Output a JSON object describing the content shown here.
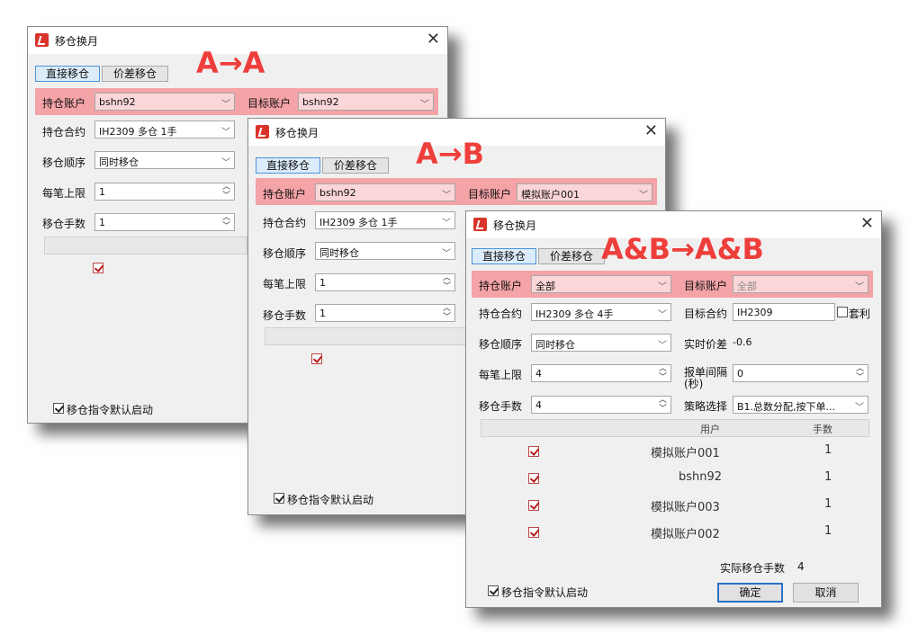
{
  "annotations": {
    "w1": "A→A",
    "w2": "A→B",
    "w3": "A&B→A&B"
  },
  "colors": {
    "highlight": "#f4a3a7",
    "annotation": "#ee3e3b",
    "accent": "#2a72c7"
  },
  "window1": {
    "title": "移仓换月",
    "tabs": [
      "直接移仓",
      "价差移仓"
    ],
    "hold_account_label": "持仓账户",
    "hold_account": "bshn92",
    "target_account_label": "目标账户",
    "target_account": "bshn92",
    "contract_label": "持仓合约",
    "contract": "IH2309 多仓 1手",
    "order_label": "移仓顺序",
    "order": "同时移仓",
    "max_label": "每笔上限",
    "max": "1",
    "qty_label": "移仓手数",
    "qty": "1",
    "default_start": "移仓指令默认启动"
  },
  "window2": {
    "title": "移仓换月",
    "tabs": [
      "直接移仓",
      "价差移仓"
    ],
    "hold_account_label": "持仓账户",
    "hold_account": "bshn92",
    "target_account_label": "目标账户",
    "target_account": "模拟账户001",
    "contract_label": "持仓合约",
    "contract": "IH2309 多仓 1手",
    "order_label": "移仓顺序",
    "order": "同时移仓",
    "max_label": "每笔上限",
    "max": "1",
    "qty_label": "移仓手数",
    "qty": "1",
    "default_start": "移仓指令默认启动"
  },
  "window3": {
    "title": "移仓换月",
    "tabs": [
      "直接移仓",
      "价差移仓"
    ],
    "hold_account_label": "持仓账户",
    "hold_account": "全部",
    "target_account_label": "目标账户",
    "target_account": "全部",
    "contract_label": "持仓合约",
    "contract": "IH2309 多仓 4手",
    "target_contract_label": "目标合约",
    "target_contract": "IH2309",
    "arb_label": "套利",
    "order_label": "移仓顺序",
    "order": "同时移仓",
    "spread_label": "实时价差",
    "spread": "-0.6",
    "max_label": "每笔上限",
    "max": "4",
    "interval_label": "报单间隔\n(秒)",
    "interval": "0",
    "qty_label": "移仓手数",
    "qty": "4",
    "strategy_label": "策略选择",
    "strategy": "B1.总数分配,按下单...",
    "table_headers": [
      "用户",
      "手数"
    ],
    "rows": [
      {
        "user": "模拟账户001",
        "lots": "1"
      },
      {
        "user": "bshn92",
        "lots": "1"
      },
      {
        "user": "模拟账户003",
        "lots": "1"
      },
      {
        "user": "模拟账户002",
        "lots": "1"
      }
    ],
    "actual_label": "实际移仓手数",
    "actual": "4",
    "default_start": "移仓指令默认启动",
    "ok": "确定",
    "cancel": "取消"
  }
}
